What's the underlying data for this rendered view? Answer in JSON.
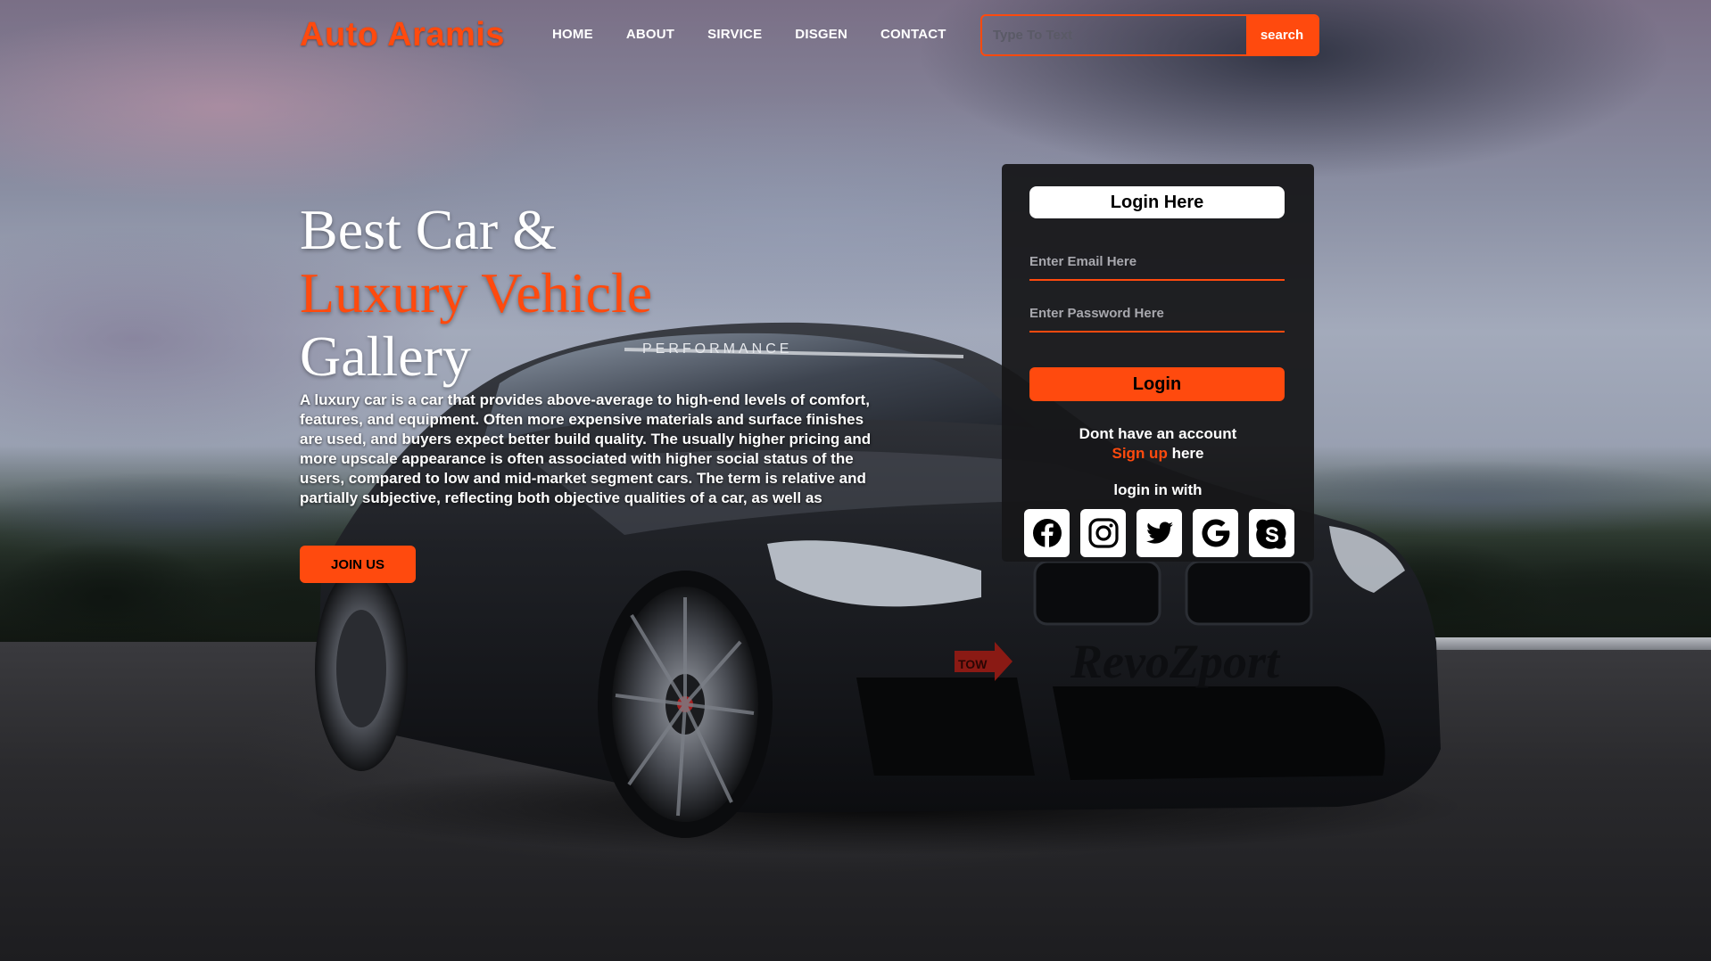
{
  "brand": {
    "logo": "Auto Aramis",
    "accent_color": "#ff4a0e"
  },
  "nav": {
    "items": [
      "HOME",
      "ABOUT",
      "SIRVICE",
      "DISGEN",
      "CONTACT"
    ]
  },
  "search": {
    "placeholder": "Type To Text",
    "button_label": "search"
  },
  "hero": {
    "title_line1": "Best Car &",
    "title_line2": "Luxury Vehicle",
    "title_line3": "Gallery",
    "description": "A luxury car is a car that provides above-average to high-end levels of comfort, features, and equipment. Often more expensive materials and surface finishes are used, and buyers expect better build quality. The usually higher pricing and more upscale appearance is often associated with higher social status of the users, compared to low and mid-market segment cars. The term is relative and partially subjective, reflecting both objective qualities of a car, as well as",
    "join_button": "JOIN US"
  },
  "login": {
    "heading": "Login Here",
    "email_placeholder": "Enter Email Here",
    "password_placeholder": "Enter Password Here",
    "login_button": "Login",
    "no_account_text": "Dont have an account",
    "signup_link": "Sign up",
    "signup_suffix": "here",
    "login_with": "login in with",
    "social_icons": [
      "facebook-icon",
      "instagram-icon",
      "twitter-icon",
      "google-icon",
      "skype-icon"
    ]
  },
  "background": {
    "car_decal_windshield": "PERFORMANCE",
    "car_decal_bumper": "RevoZport",
    "tow_tag": "TOW"
  }
}
